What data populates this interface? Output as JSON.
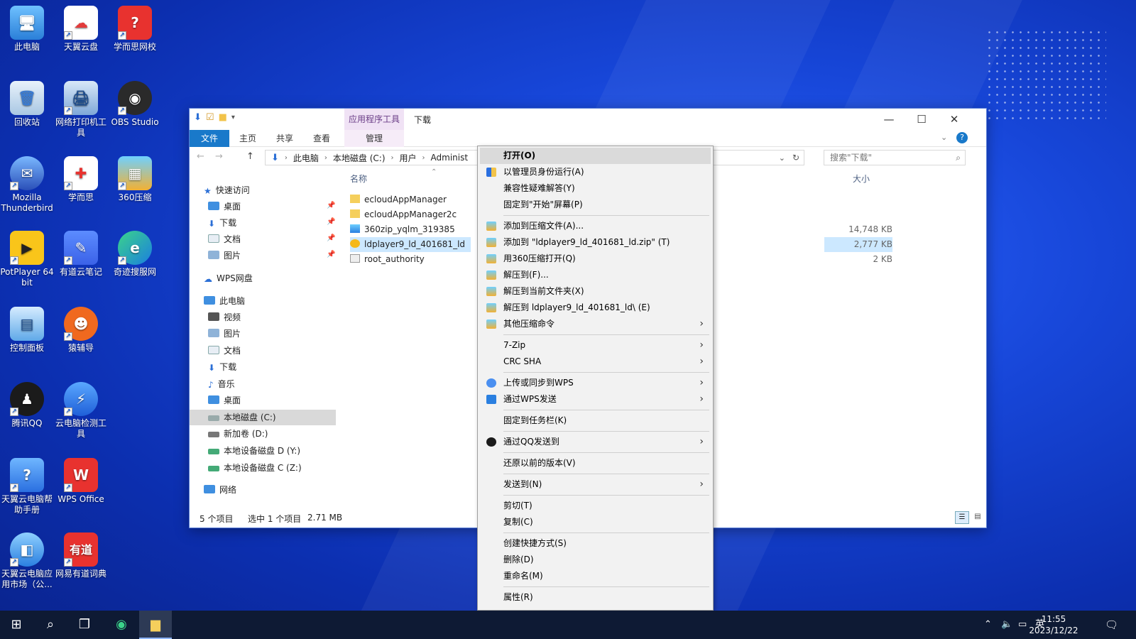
{
  "desktop": {
    "icons": [
      {
        "label": "此电脑",
        "glyph": "🖥"
      },
      {
        "label": "天翼云盘",
        "glyph": "☁"
      },
      {
        "label": "学而思网校",
        "glyph": "?"
      },
      {
        "label": "回收站",
        "glyph": "🗑"
      },
      {
        "label": "网络打印机工具",
        "glyph": "🖨"
      },
      {
        "label": "OBS Studio",
        "glyph": "◉"
      },
      {
        "label": "Mozilla Thunderbird",
        "glyph": "✉"
      },
      {
        "label": "学而思",
        "glyph": "✚"
      },
      {
        "label": "360压缩",
        "glyph": "▦"
      },
      {
        "label": "PotPlayer 64 bit",
        "glyph": "▶"
      },
      {
        "label": "有道云笔记",
        "glyph": "✎"
      },
      {
        "label": "奇迹搜服网",
        "glyph": "e"
      },
      {
        "label": "控制面板",
        "glyph": "▤"
      },
      {
        "label": "猿辅导",
        "glyph": "☻"
      },
      {
        "label": "腾讯QQ",
        "glyph": "♟"
      },
      {
        "label": "云电脑检测工具",
        "glyph": "⚡"
      },
      {
        "label": "天翼云电脑帮助手册",
        "glyph": "?"
      },
      {
        "label": "WPS Office",
        "glyph": "W"
      },
      {
        "label": "天翼云电脑应用市场（公...",
        "glyph": "◧"
      },
      {
        "label": "网易有道词典",
        "glyph": "有道"
      }
    ]
  },
  "explorer": {
    "title": "下载",
    "context_tool_header": "应用程序工具",
    "tabs": {
      "file": "文件",
      "home": "主页",
      "share": "共享",
      "view": "查看",
      "manage": "管理"
    },
    "breadcrumb": [
      "此电脑",
      "本地磁盘 (C:)",
      "用户",
      "Administ"
    ],
    "search_placeholder": "搜索\"下载\"",
    "nav": {
      "quick_access": "快速访问",
      "quick_items": [
        "桌面",
        "下载",
        "文档",
        "图片"
      ],
      "wps": "WPS网盘",
      "this_pc": "此电脑",
      "pc_items": [
        "视频",
        "图片",
        "文档",
        "下载",
        "音乐",
        "桌面",
        "本地磁盘 (C:)",
        "新加卷 (D:)",
        "本地设备磁盘 D (Y:)",
        "本地设备磁盘 C (Z:)"
      ],
      "network": "网络"
    },
    "columns": {
      "name": "名称",
      "size": "大小"
    },
    "files": [
      {
        "name": "ecloudAppManager",
        "size": ""
      },
      {
        "name": "ecloudAppManager2c",
        "size": ""
      },
      {
        "name": "360zip_yqlm_319385",
        "size": "14,748 KB"
      },
      {
        "name": "ldplayer9_ld_401681_ld",
        "size": "2,777 KB"
      },
      {
        "name": "root_authority",
        "size": "2 KB"
      }
    ],
    "status": {
      "count": "5 个项目",
      "selected": "选中 1 个项目",
      "selected_size": "2.71 MB"
    }
  },
  "context_menu": {
    "items": [
      "打开(O)",
      "以管理员身份运行(A)",
      "兼容性疑难解答(Y)",
      "固定到\"开始\"屏幕(P)",
      "添加到压缩文件(A)...",
      "添加到 \"ldplayer9_ld_401681_ld.zip\" (T)",
      "用360压缩打开(Q)",
      "解压到(F)...",
      "解压到当前文件夹(X)",
      "解压到 ldplayer9_ld_401681_ld\\ (E)",
      "其他压缩命令",
      "7-Zip",
      "CRC SHA",
      "上传或同步到WPS",
      "通过WPS发送",
      "固定到任务栏(K)",
      "通过QQ发送到",
      "还原以前的版本(V)",
      "发送到(N)",
      "剪切(T)",
      "复制(C)",
      "创建快捷方式(S)",
      "删除(D)",
      "重命名(M)",
      "属性(R)"
    ]
  },
  "taskbar": {
    "ime": "英",
    "time": "11:55",
    "date": "2023/12/22"
  }
}
